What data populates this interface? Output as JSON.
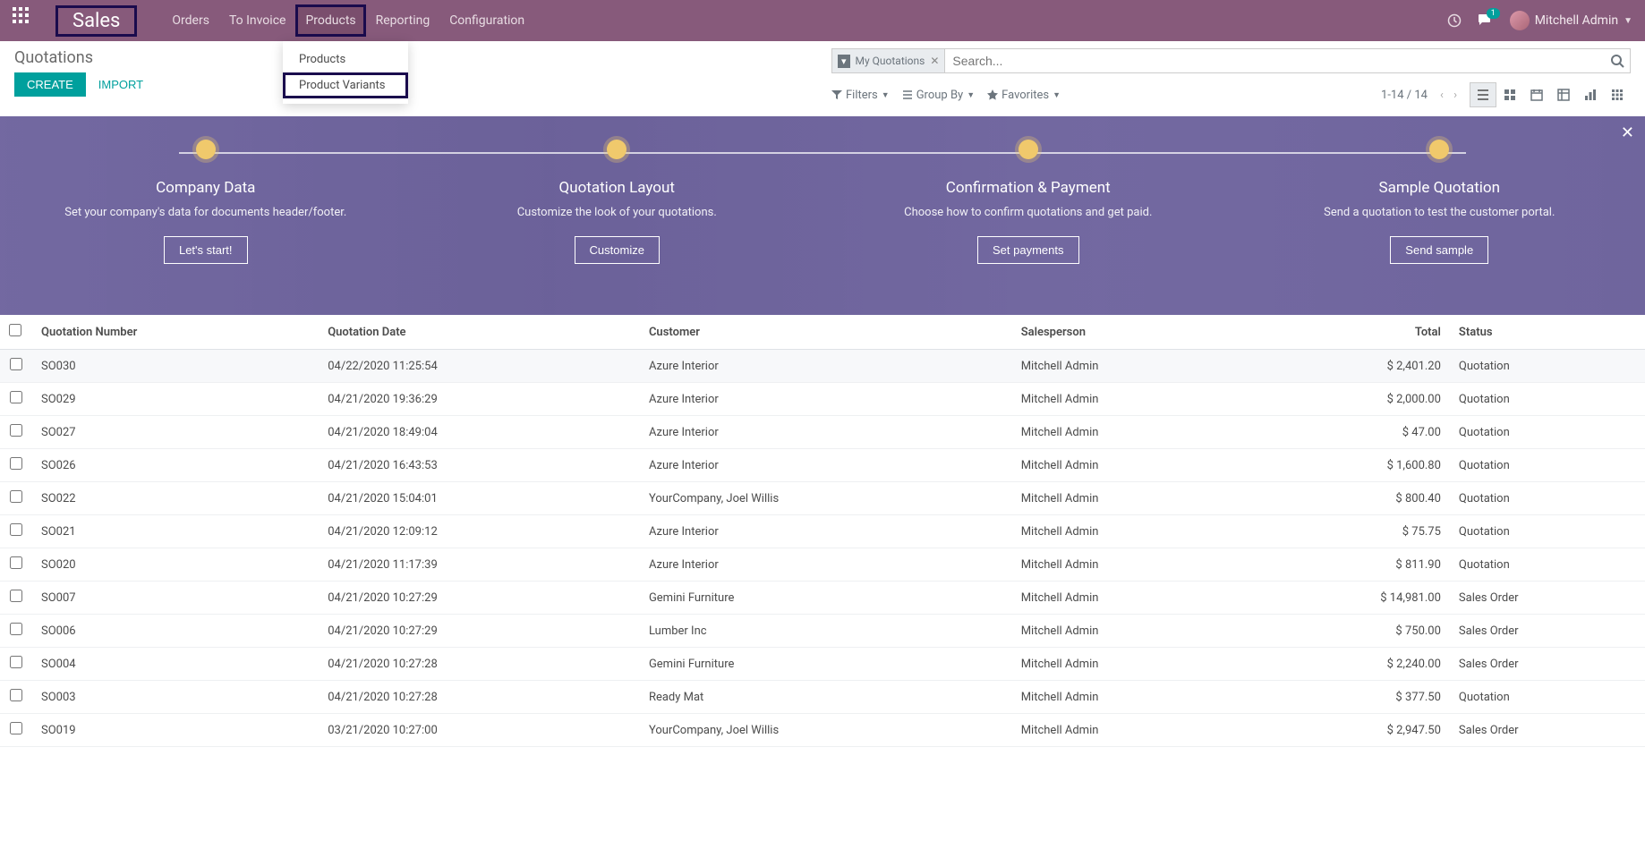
{
  "nav": {
    "app_name": "Sales",
    "items": [
      "Orders",
      "To Invoice",
      "Products",
      "Reporting",
      "Configuration"
    ],
    "active_index": 2,
    "dropdown": {
      "items": [
        "Products",
        "Product Variants"
      ],
      "highlight_index": 1
    },
    "user_name": "Mitchell Admin",
    "notification_count": "1"
  },
  "breadcrumb": "Quotations",
  "buttons": {
    "create": "CREATE",
    "import": "IMPORT"
  },
  "search": {
    "chip_label": "My Quotations",
    "placeholder": "Search..."
  },
  "toolbar": {
    "filters": "Filters",
    "group_by": "Group By",
    "favorites": "Favorites",
    "pager": "1-14 / 14"
  },
  "onboarding": {
    "steps": [
      {
        "title": "Company Data",
        "desc": "Set your company's data for documents header/footer.",
        "btn": "Let's start!"
      },
      {
        "title": "Quotation Layout",
        "desc": "Customize the look of your quotations.",
        "btn": "Customize"
      },
      {
        "title": "Confirmation & Payment",
        "desc": "Choose how to confirm quotations and get paid.",
        "btn": "Set payments"
      },
      {
        "title": "Sample Quotation",
        "desc": "Send a quotation to test the customer portal.",
        "btn": "Send sample"
      }
    ]
  },
  "table": {
    "headers": [
      "Quotation Number",
      "Quotation Date",
      "Customer",
      "Salesperson",
      "Total",
      "Status"
    ],
    "rows": [
      {
        "num": "SO030",
        "date": "04/22/2020 11:25:54",
        "cust": "Azure Interior",
        "sp": "Mitchell Admin",
        "total": "$ 2,401.20",
        "status": "Quotation"
      },
      {
        "num": "SO029",
        "date": "04/21/2020 19:36:29",
        "cust": "Azure Interior",
        "sp": "Mitchell Admin",
        "total": "$ 2,000.00",
        "status": "Quotation"
      },
      {
        "num": "SO027",
        "date": "04/21/2020 18:49:04",
        "cust": "Azure Interior",
        "sp": "Mitchell Admin",
        "total": "$ 47.00",
        "status": "Quotation"
      },
      {
        "num": "SO026",
        "date": "04/21/2020 16:43:53",
        "cust": "Azure Interior",
        "sp": "Mitchell Admin",
        "total": "$ 1,600.80",
        "status": "Quotation"
      },
      {
        "num": "SO022",
        "date": "04/21/2020 15:04:01",
        "cust": "YourCompany, Joel Willis",
        "sp": "Mitchell Admin",
        "total": "$ 800.40",
        "status": "Quotation"
      },
      {
        "num": "SO021",
        "date": "04/21/2020 12:09:12",
        "cust": "Azure Interior",
        "sp": "Mitchell Admin",
        "total": "$ 75.75",
        "status": "Quotation"
      },
      {
        "num": "SO020",
        "date": "04/21/2020 11:17:39",
        "cust": "Azure Interior",
        "sp": "Mitchell Admin",
        "total": "$ 811.90",
        "status": "Quotation"
      },
      {
        "num": "SO007",
        "date": "04/21/2020 10:27:29",
        "cust": "Gemini Furniture",
        "sp": "Mitchell Admin",
        "total": "$ 14,981.00",
        "status": "Sales Order"
      },
      {
        "num": "SO006",
        "date": "04/21/2020 10:27:29",
        "cust": "Lumber Inc",
        "sp": "Mitchell Admin",
        "total": "$ 750.00",
        "status": "Sales Order"
      },
      {
        "num": "SO004",
        "date": "04/21/2020 10:27:28",
        "cust": "Gemini Furniture",
        "sp": "Mitchell Admin",
        "total": "$ 2,240.00",
        "status": "Sales Order"
      },
      {
        "num": "SO003",
        "date": "04/21/2020 10:27:28",
        "cust": "Ready Mat",
        "sp": "Mitchell Admin",
        "total": "$ 377.50",
        "status": "Quotation"
      },
      {
        "num": "SO019",
        "date": "03/21/2020 10:27:00",
        "cust": "YourCompany, Joel Willis",
        "sp": "Mitchell Admin",
        "total": "$ 2,947.50",
        "status": "Sales Order"
      }
    ]
  }
}
